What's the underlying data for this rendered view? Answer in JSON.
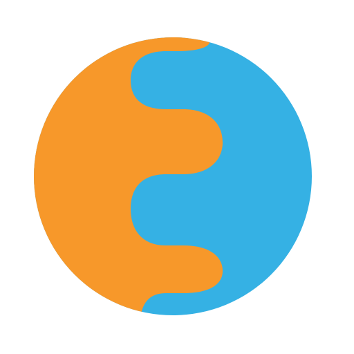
{
  "logo": {
    "colors": {
      "left": "#F7982A",
      "right": "#35B1E4",
      "background": "#FFFFFF"
    }
  }
}
